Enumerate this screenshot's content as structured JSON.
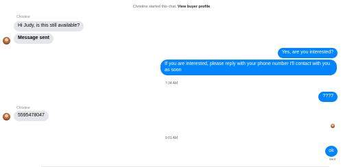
{
  "system_notice": {
    "text": "Christine started this chat.",
    "link": "View buyer profile"
  },
  "messages": [
    {
      "sender": "Christine",
      "text": "Hi Judy, is this still available?"
    },
    {
      "text": "Message sent"
    },
    {
      "text": "Yes, are you interested?"
    },
    {
      "text": "If you are interested, please reply with your phone number  I'll contact with you as soon"
    },
    {
      "timestamp": "7:34 AM"
    },
    {
      "text": "????"
    },
    {
      "sender": "Christine",
      "text": "5595478047"
    },
    {
      "timestamp": "9:01 AM"
    },
    {
      "text": "ok",
      "status": "Sent"
    }
  ],
  "colors": {
    "outgoing": "#0084ff",
    "incoming": "#e4e6eb"
  }
}
